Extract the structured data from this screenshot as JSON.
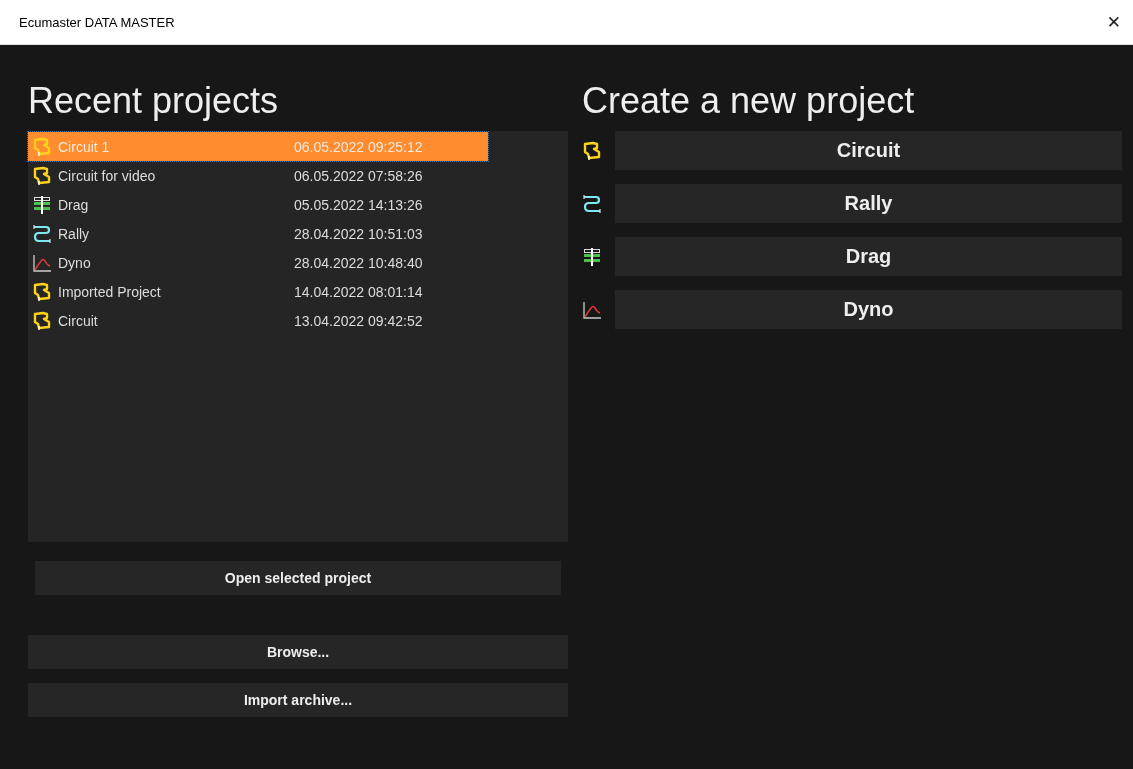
{
  "window": {
    "title": "Ecumaster DATA MASTER",
    "close": "✕"
  },
  "recent": {
    "heading": "Recent projects",
    "projects": [
      {
        "name": "Circuit 1",
        "date": "06.05.2022 09:25:12",
        "kind": "circuit",
        "selected": true
      },
      {
        "name": "Circuit for video",
        "date": "06.05.2022 07:58:26",
        "kind": "circuit",
        "selected": false
      },
      {
        "name": "Drag",
        "date": "05.05.2022 14:13:26",
        "kind": "drag",
        "selected": false
      },
      {
        "name": "Rally",
        "date": "28.04.2022 10:51:03",
        "kind": "rally",
        "selected": false
      },
      {
        "name": "Dyno",
        "date": "28.04.2022 10:48:40",
        "kind": "dyno",
        "selected": false
      },
      {
        "name": "Imported Project",
        "date": "14.04.2022 08:01:14",
        "kind": "circuit",
        "selected": false
      },
      {
        "name": "Circuit",
        "date": "13.04.2022 09:42:52",
        "kind": "circuit",
        "selected": false
      }
    ],
    "open_button": "Open selected project",
    "browse_button": "Browse...",
    "import_button": "Import archive..."
  },
  "create": {
    "heading": "Create a new project",
    "types": [
      {
        "label": "Circuit",
        "kind": "circuit"
      },
      {
        "label": "Rally",
        "kind": "rally"
      },
      {
        "label": "Drag",
        "kind": "drag"
      },
      {
        "label": "Dyno",
        "kind": "dyno"
      }
    ]
  }
}
